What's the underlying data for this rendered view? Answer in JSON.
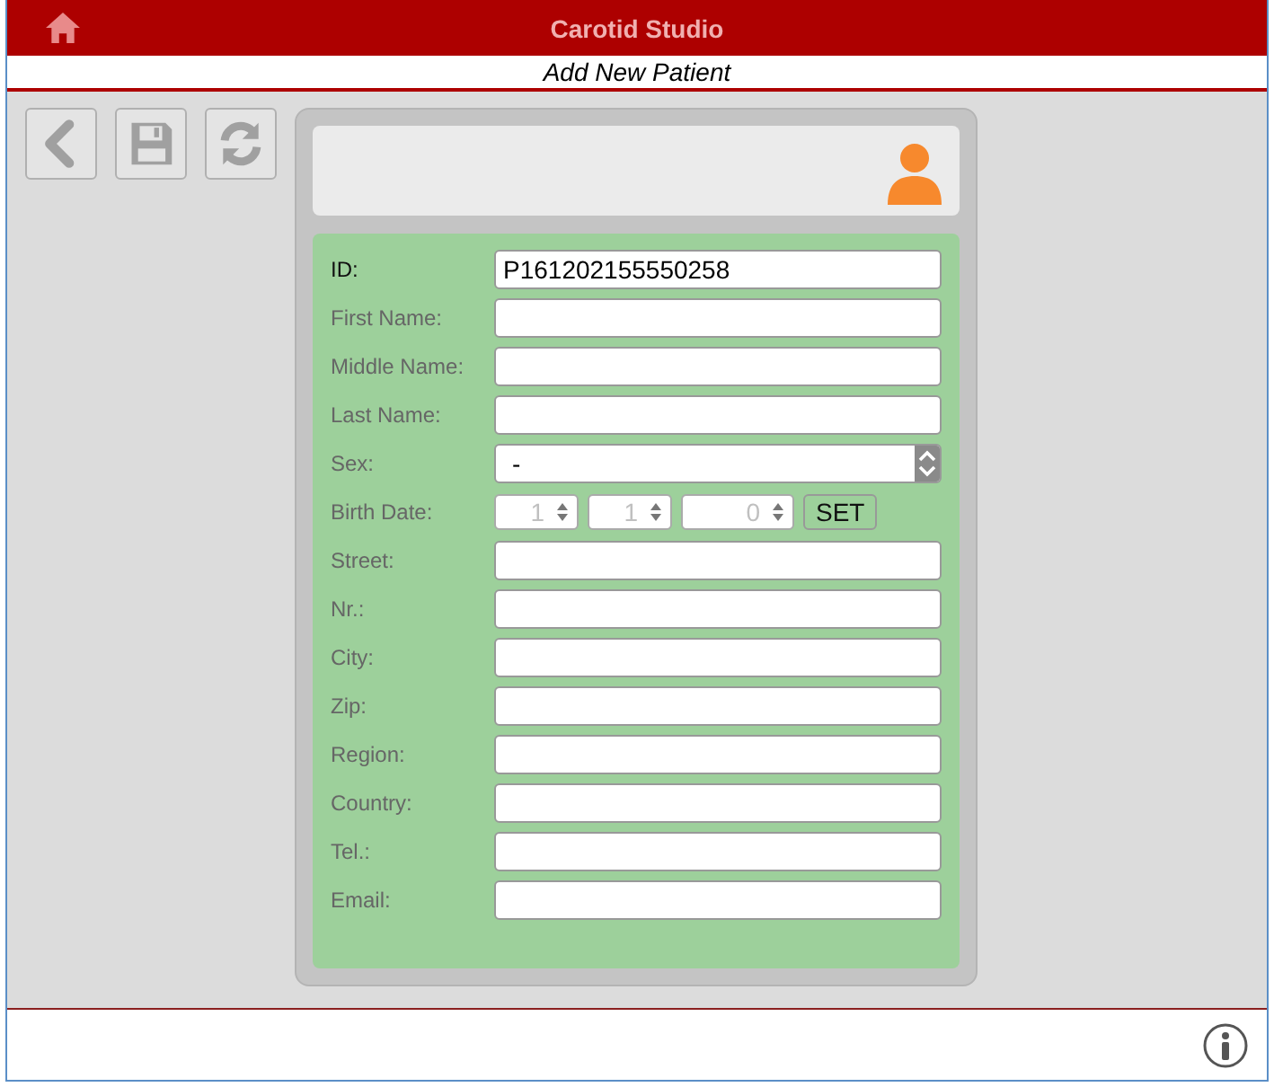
{
  "app": {
    "title": "Carotid Studio"
  },
  "page": {
    "title": "Add New Patient"
  },
  "fields": [
    {
      "kind": "text",
      "label": "ID:",
      "value": "P161202155550258",
      "emphasized": true
    },
    {
      "kind": "text",
      "label": "First Name:",
      "emphasized": false
    },
    {
      "kind": "text",
      "label": "Middle Name:",
      "emphasized": false
    },
    {
      "kind": "text",
      "label": "Last Name:",
      "emphasized": false
    },
    {
      "kind": "select",
      "label": "Sex:",
      "value": "-",
      "emphasized": false
    },
    {
      "kind": "date",
      "label": "Birth Date:",
      "emphasized": false,
      "parts": [
        {
          "value": "1",
          "disabled": true
        },
        {
          "value": "1",
          "disabled": true
        },
        {
          "value": "0",
          "disabled": true
        }
      ],
      "button": "SET"
    },
    {
      "kind": "text",
      "label": "Street:",
      "emphasized": false
    },
    {
      "kind": "text",
      "label": "Nr.:",
      "emphasized": false
    },
    {
      "kind": "text",
      "label": "City:",
      "emphasized": false
    },
    {
      "kind": "text",
      "label": "Zip:",
      "emphasized": false
    },
    {
      "kind": "text",
      "label": "Region:",
      "emphasized": false
    },
    {
      "kind": "text",
      "label": "Country:",
      "emphasized": false
    },
    {
      "kind": "text",
      "label": "Tel.:",
      "emphasized": false
    },
    {
      "kind": "text",
      "label": "Email:",
      "emphasized": false
    }
  ]
}
